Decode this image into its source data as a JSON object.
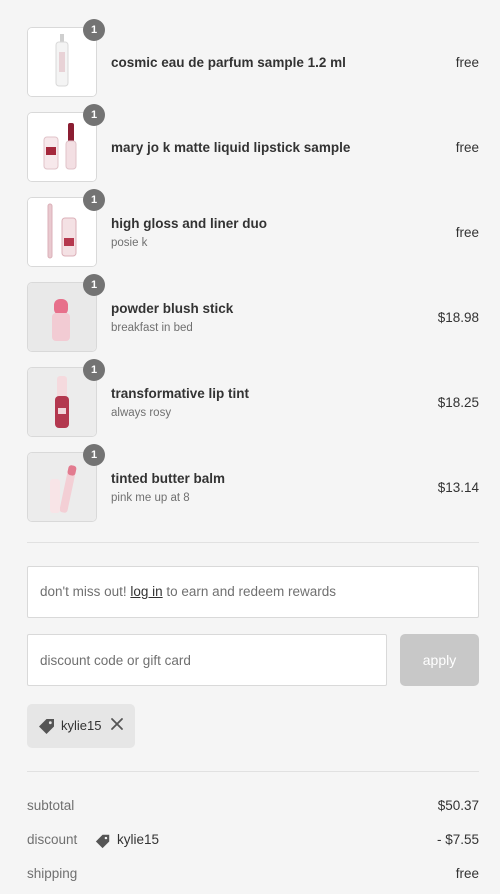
{
  "items": [
    {
      "name": "cosmic eau de parfum sample 1.2 ml",
      "variant": "",
      "price": "free",
      "qty": "1",
      "image": "perfume-sample-vial"
    },
    {
      "name": "mary jo k matte liquid lipstick sample",
      "variant": "",
      "price": "free",
      "qty": "1",
      "image": "lipstick-sample"
    },
    {
      "name": "high gloss and liner duo",
      "variant": "posie k",
      "price": "free",
      "qty": "1",
      "image": "gloss-liner-duo"
    },
    {
      "name": "powder blush stick",
      "variant": "breakfast in bed",
      "price": "$18.98",
      "qty": "1",
      "image": "blush-stick"
    },
    {
      "name": "transformative lip tint",
      "variant": "always rosy",
      "price": "$18.25",
      "qty": "1",
      "image": "lip-tint"
    },
    {
      "name": "tinted butter balm",
      "variant": "pink me up at 8",
      "price": "$13.14",
      "qty": "1",
      "image": "butter-balm"
    }
  ],
  "rewards": {
    "prefix": "don't miss out! ",
    "link": "log in",
    "suffix": " to earn and redeem rewards"
  },
  "discount": {
    "placeholder": "discount code or gift card",
    "value": "",
    "apply_label": "apply"
  },
  "applied_tag": {
    "code": "kylie15",
    "icon": "tag-icon",
    "remove_icon": "close-icon"
  },
  "summary": {
    "subtotal_label": "subtotal",
    "subtotal_value": "$50.37",
    "discount_label": "discount",
    "discount_code": "kylie15",
    "discount_value": "- $7.55",
    "shipping_label": "shipping",
    "shipping_value": "free"
  },
  "colors": {
    "badge": "#737373",
    "apply_disabled": "#c8c8c8",
    "tag_bg": "#e6e6e6",
    "text": "#333333",
    "muted": "#707070"
  }
}
